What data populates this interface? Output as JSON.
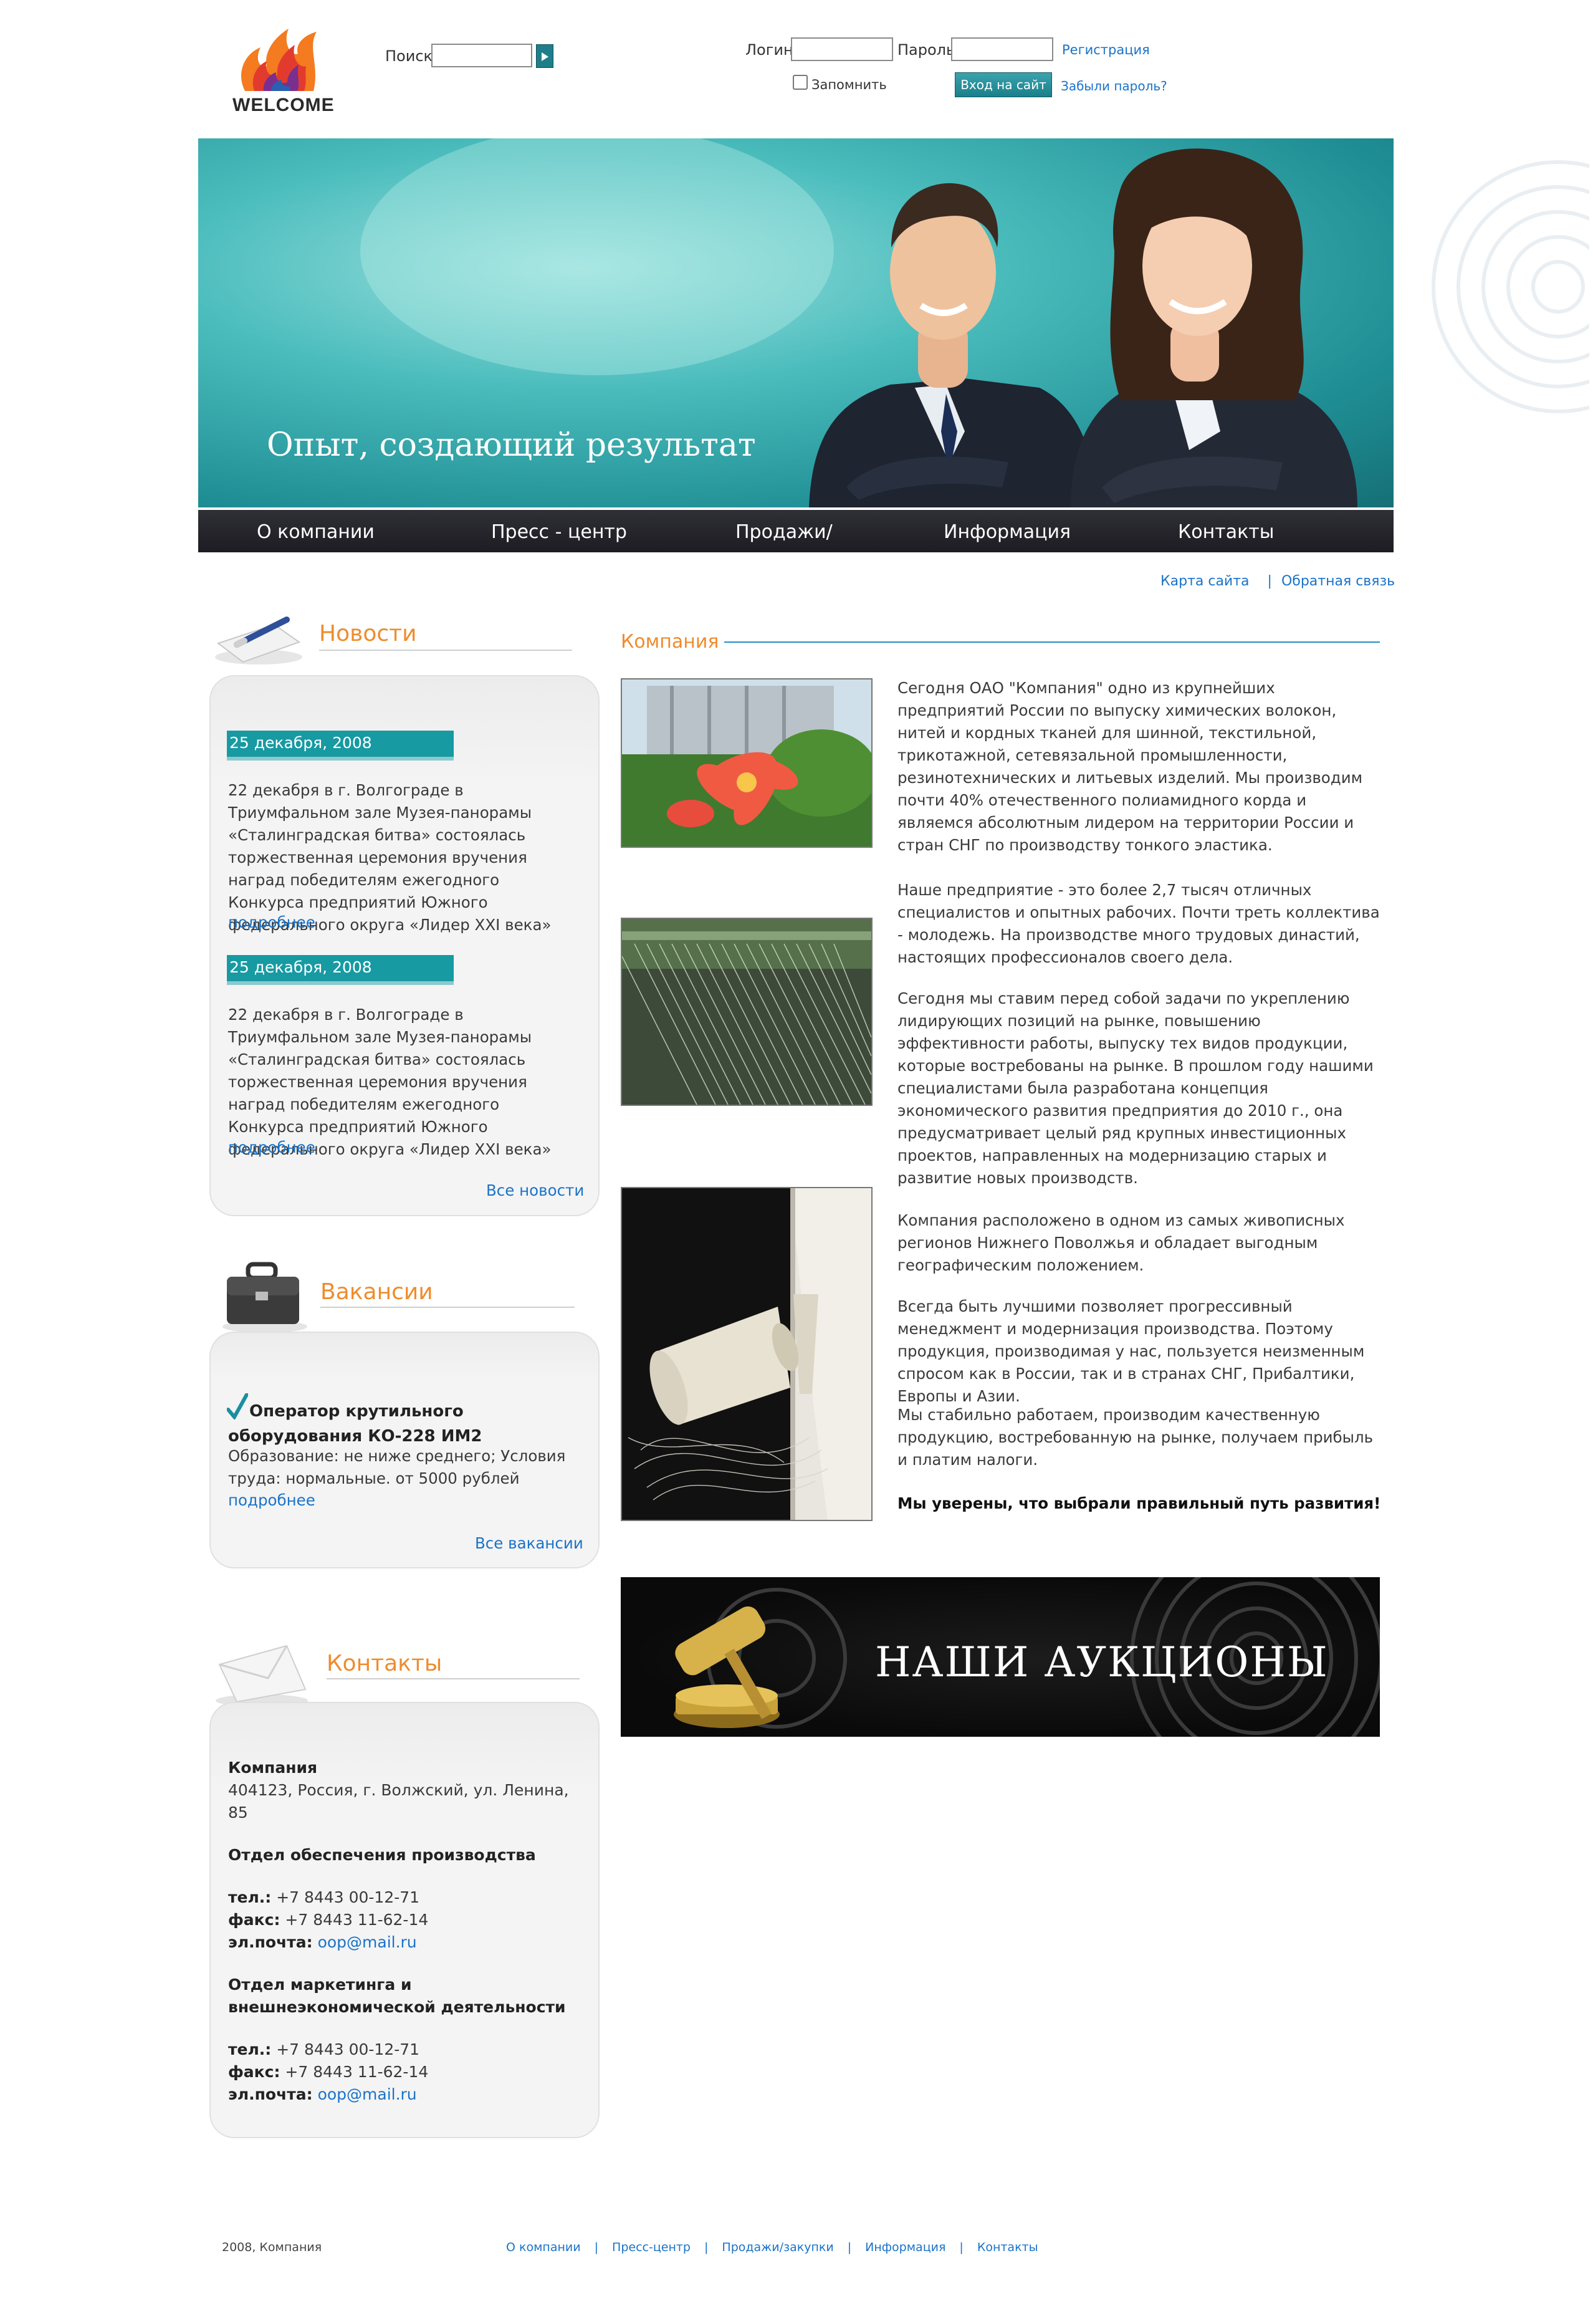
{
  "header": {
    "logo_text": "WELCOME",
    "search_label": "Поиск",
    "login_label": "Логин",
    "password_label": "Пароль",
    "register_link": "Регистрация",
    "remember_label": "Запомнить",
    "login_button": "Вход на сайт",
    "forgot_link": "Забыли пароль?"
  },
  "hero": {
    "slogan": "Опыт, создающий результат"
  },
  "nav": {
    "items": [
      "О  компании",
      "Пресс - центр",
      "Продажи/",
      "Информация",
      "Контакты"
    ]
  },
  "sub_links": {
    "sitemap": "Карта сайта",
    "separator": "|",
    "feedback": "Обратная связь"
  },
  "news": {
    "title": "Новости",
    "items": [
      {
        "date": "25 декабря, 2008",
        "text": "22 декабря в г. Волгограде в Триумфальном зале Музея-панорамы «Сталинградская битва» состоялась торжественная церемония вручения наград победителям ежегодного Конкурса предприятий Южного федерального округа «Лидер XXI века»",
        "more": "подробнее"
      },
      {
        "date": "25 декабря, 2008",
        "text": "22 декабря в г. Волгограде в Триумфальном зале Музея-панорамы «Сталинградская битва» состоялась торжественная церемония вручения наград победителям ежегодного Конкурса предприятий Южного федерального округа «Лидер XXI века»",
        "more": "подробнее"
      }
    ],
    "all_link": "Все новости"
  },
  "vacancies": {
    "title": "Вакансии",
    "item_title": "Оператор крутильного оборудования КО-228 ИМ2",
    "item_text": "Образование: не ниже среднего; Условия труда: нормальные. от 5000 рублей",
    "more": "подробнее",
    "all_link": "Все вакансии"
  },
  "contacts": {
    "title": "Контакты",
    "company_name": "Компания",
    "address": "404123, Россия, г. Волжский, ул. Ленина, 85",
    "dept1": {
      "name": "Отдел обеспечения производства",
      "phone_label": "тел.:",
      "phone": "+7 8443 00-12-71",
      "fax_label": "факс:",
      "fax": "+7 8443 11-62-14",
      "email_label": "эл.почта:",
      "email": "oop@mail.ru"
    },
    "dept2": {
      "name": "Отдел маркетинга и внешнеэкономической деятельности",
      "phone_label": "тел.:",
      "phone": "+7 8443 00-12-71",
      "fax_label": "факс:",
      "fax": "+7 8443 11-62-14",
      "email_label": "эл.почта:",
      "email": "oop@mail.ru"
    }
  },
  "company": {
    "section_title": "Компания",
    "paragraphs": [
      "Сегодня ОАО \"Компания\" одно из крупнейших предприятий России по выпуску химических волокон, нитей и кордных тканей для шинной, текстильной, трикотажной, сетевязальной промышленности, резинотехнических и литьевых изделий. Мы производим почти 40% отечественного полиамидного корда и являемся абсолютным лидером на территории России и стран СНГ по производству тонкого эластика.",
      "Наше предприятие - это более 2,7 тысяч отличных специалистов и опытных рабочих. Почти треть коллектива - молодежь. На производстве много трудовых династий, настоящих профессионалов своего дела.",
      "Сегодня мы ставим перед собой задачи по укреплению лидирующих позиций на рынке, повышению эффективности работы, выпуску тех видов продукции, которые востребованы на рынке. В прошлом году нашими специалистами была разработана концепция экономического развития предприятия до 2010 г., она предусматривает целый ряд крупных инвестиционных проектов, направленных на модернизацию старых и развитие новых производств.",
      "Компания расположено в одном из самых живописных регионов Нижнего Поволжья и обладает выгодным географическим положением.",
      "Всегда быть лучшими позволяет прогрессивный менеджмент и модернизация производства. Поэтому продукция, производимая у нас, пользуется неизменным спросом как в России, так и в странах СНГ, Прибалтики, Европы и Азии.",
      "Мы стабильно работаем, производим качественную продукцию, востребованную на рынке, получаем прибыль и платим налоги."
    ],
    "closing": "Мы уверены, что выбрали правильный путь развития!"
  },
  "auction": {
    "text": "НАШИ АУКЦИОНЫ"
  },
  "footer": {
    "copyright": "2008, Компания",
    "separator": "|",
    "links": [
      "О компании",
      "Пресс-центр",
      "Продажи/закупки",
      "Информация",
      "Контакты"
    ]
  },
  "colors": {
    "accent_orange": "#ef8c2d",
    "teal": "#179aa2",
    "link_blue": "#1a73c9",
    "nav_dark": "#25252b"
  }
}
